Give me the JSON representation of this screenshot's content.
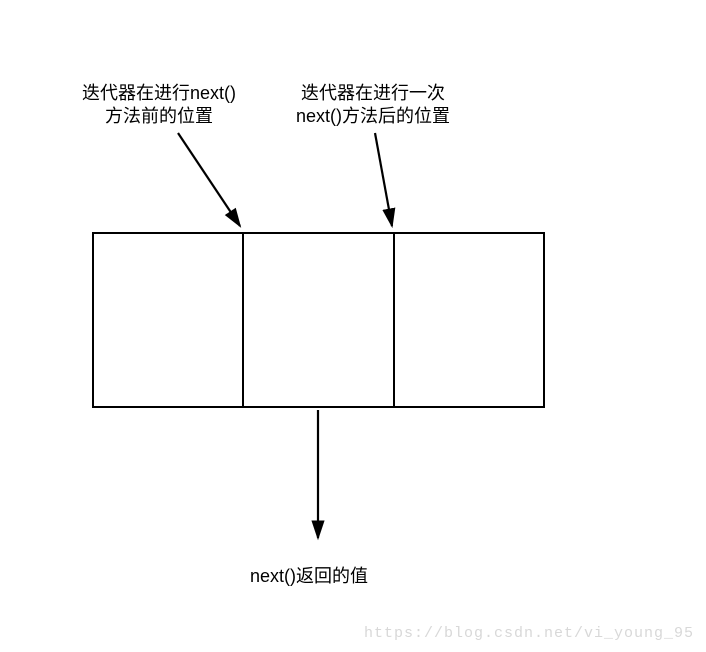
{
  "labels": {
    "left_line1": "迭代器在进行next()",
    "left_line2": "方法前的位置",
    "right_line1": "迭代器在进行一次",
    "right_line2": "next()方法后的位置",
    "bottom": "next()返回的值"
  },
  "structure": {
    "row": {
      "cells": 3,
      "note": "three-cell row illustrating iterator positions"
    },
    "arrows": [
      {
        "from": "label-left",
        "to": "first-divider-top",
        "name": "arrow-before-next"
      },
      {
        "from": "label-right",
        "to": "second-divider-top",
        "name": "arrow-after-next"
      },
      {
        "from": "middle-cell-bottom",
        "to": "label-bottom",
        "name": "arrow-return-value"
      }
    ]
  },
  "watermark": "https://blog.csdn.net/vi_young_95"
}
